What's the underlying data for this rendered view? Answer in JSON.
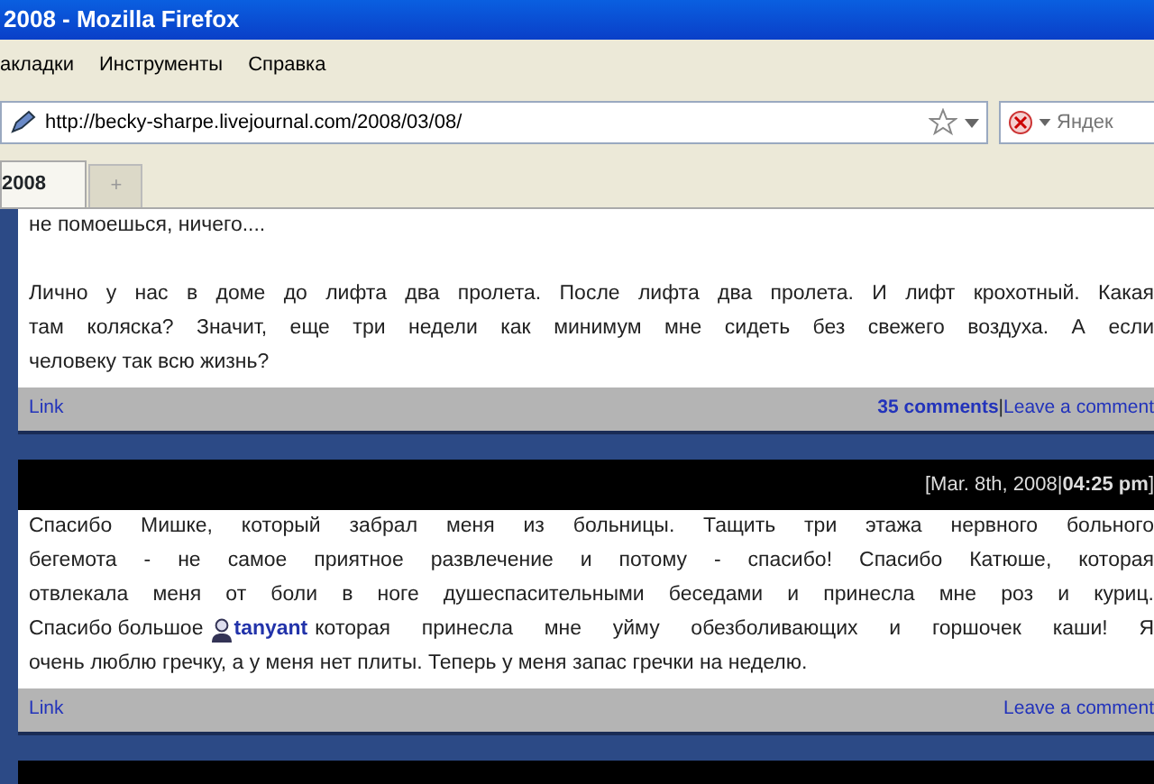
{
  "window": {
    "title": "2008 - Mozilla Firefox"
  },
  "menu": [
    "акладки",
    "Инструменты",
    "Справка"
  ],
  "address_bar": {
    "value": "http://becky-sharpe.livejournal.com/2008/03/08/"
  },
  "search": {
    "placeholder": "Яндек"
  },
  "tabs": [
    {
      "label": "2008",
      "selected": true
    }
  ],
  "new_tab": "+",
  "entries": [
    {
      "paragraphs": [
        [
          "не помоешься, ничего...."
        ],
        [
          "Лично у нас в доме до лифта два пролета. После лифта два пролета. И лифт крохотный. Какая",
          "там коляска? Значит, еще три недели как минимум мне сидеть без свежего воздуха. А если",
          "человеку так всю жизнь?"
        ]
      ],
      "footer": {
        "link": "Link",
        "comments": "35 comments",
        "separator": "|",
        "leave": "Leave a comment"
      }
    },
    {
      "header": "[Mar. 8th, 2008|**04:25 pm**]",
      "paragraphs": [
        [
          "Спасибо Мишке, который забрал меня из больницы. Тащить три этажа нервного больного",
          "бегемота - не самое приятное развлечение и потому - спасибо! Спасибо Катюше, которая",
          "отвлекала меня от боли в ноге душеспасительными беседами и принесла мне роз и куриц.",
          {
            "before": "Спасибо большое",
            "user": "tanyant",
            "after": "которая принесла мне уйму обезболивающих и горшочек каши! Я"
          },
          "очень люблю гречку, а у меня нет плиты. Теперь у меня запас гречки на неделю."
        ]
      ],
      "footer": {
        "link": "Link",
        "leave": "Leave a comment"
      }
    }
  ]
}
